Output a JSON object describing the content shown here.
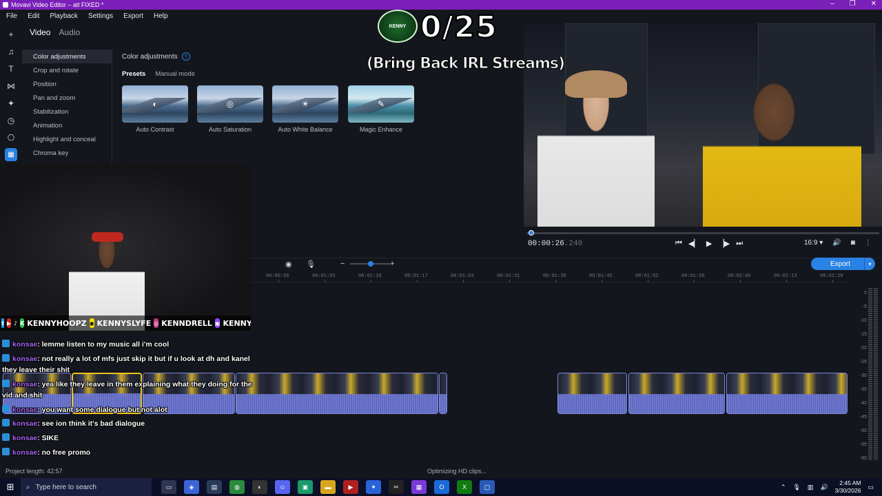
{
  "window": {
    "title": "Movavi Video Editor – atl FIXED *",
    "controls": [
      "–",
      "❐",
      "✕"
    ]
  },
  "menu": [
    "File",
    "Edit",
    "Playback",
    "Settings",
    "Export",
    "Help"
  ],
  "tools": [
    "+",
    "♫",
    "T",
    "⋈",
    "✦",
    "◷",
    "⎔",
    "▦"
  ],
  "tabs": {
    "video": "Video",
    "audio": "Audio"
  },
  "sidebar": [
    "Color adjustments",
    "Crop and rotate",
    "Position",
    "Pan and zoom",
    "Stabilization",
    "Animation",
    "Highlight and conceal",
    "Chroma key"
  ],
  "panel": {
    "title": "Color adjustments",
    "help": "?",
    "presets_tab": "Presets",
    "manual_tab": "Manual mode"
  },
  "presets": [
    {
      "label": "Auto Contrast",
      "icon": "◐"
    },
    {
      "label": "Auto Saturation",
      "icon": "◎"
    },
    {
      "label": "Auto White Balance",
      "icon": "☀"
    },
    {
      "label": "Magic Enhance",
      "icon": "✎"
    }
  ],
  "overlay": {
    "logo": "KENNY",
    "count": "0/25",
    "subtitle": "(Bring Back IRL Streams)"
  },
  "player": {
    "time": "00:00:26",
    "frames": ".240",
    "aspect": "16:9 ▾",
    "progress": 0.005
  },
  "timeline": {
    "ticks": [
      "00:00:56",
      "00:01:03",
      "00:01:10",
      "00:01:17",
      "00:01:24",
      "00:01:31",
      "00:01:38",
      "00:01:45",
      "00:01:52",
      "00:01:59",
      "00:02:06",
      "00:02:13",
      "00:02:20"
    ],
    "export_label": "Export",
    "meter_labels": [
      "0",
      "-5",
      "-10",
      "-15",
      "-20",
      "-25",
      "-30",
      "-35",
      "-40",
      "-45",
      "-50",
      "-55",
      "-60"
    ]
  },
  "webcam": {
    "handles": [
      "KENNYHOOPZ",
      "KENNYSLYFE",
      "KENNDRELL",
      "KENNY"
    ]
  },
  "chat": [
    {
      "user": "konsae",
      "text": ": lemme listen to my music all i'm cool"
    },
    {
      "user": "konsae",
      "text": ": not really a lot of mfs just skip it but if u look at dh and kanel"
    },
    {
      "user": "",
      "text": "they leave their shit"
    },
    {
      "user": "konsae",
      "text": ": yea like they leave in them explaining what they doing for the"
    },
    {
      "user": "",
      "text": "vid and shit"
    },
    {
      "user": "konsae",
      "text": ": you want some dialogue but not alot"
    },
    {
      "user": "konsae",
      "text": ": see ion think it's bad dialogue"
    },
    {
      "user": "konsae",
      "text": ": SIKE"
    },
    {
      "user": "konsae",
      "text": ": no free promo"
    }
  ],
  "status": {
    "project_length": "Project length: 42:57",
    "optimizing": "Optimizing HD clips..."
  },
  "taskbar": {
    "search_placeholder": "Type here to search",
    "time": "2:45 AM",
    "date": "3/30/2026"
  }
}
